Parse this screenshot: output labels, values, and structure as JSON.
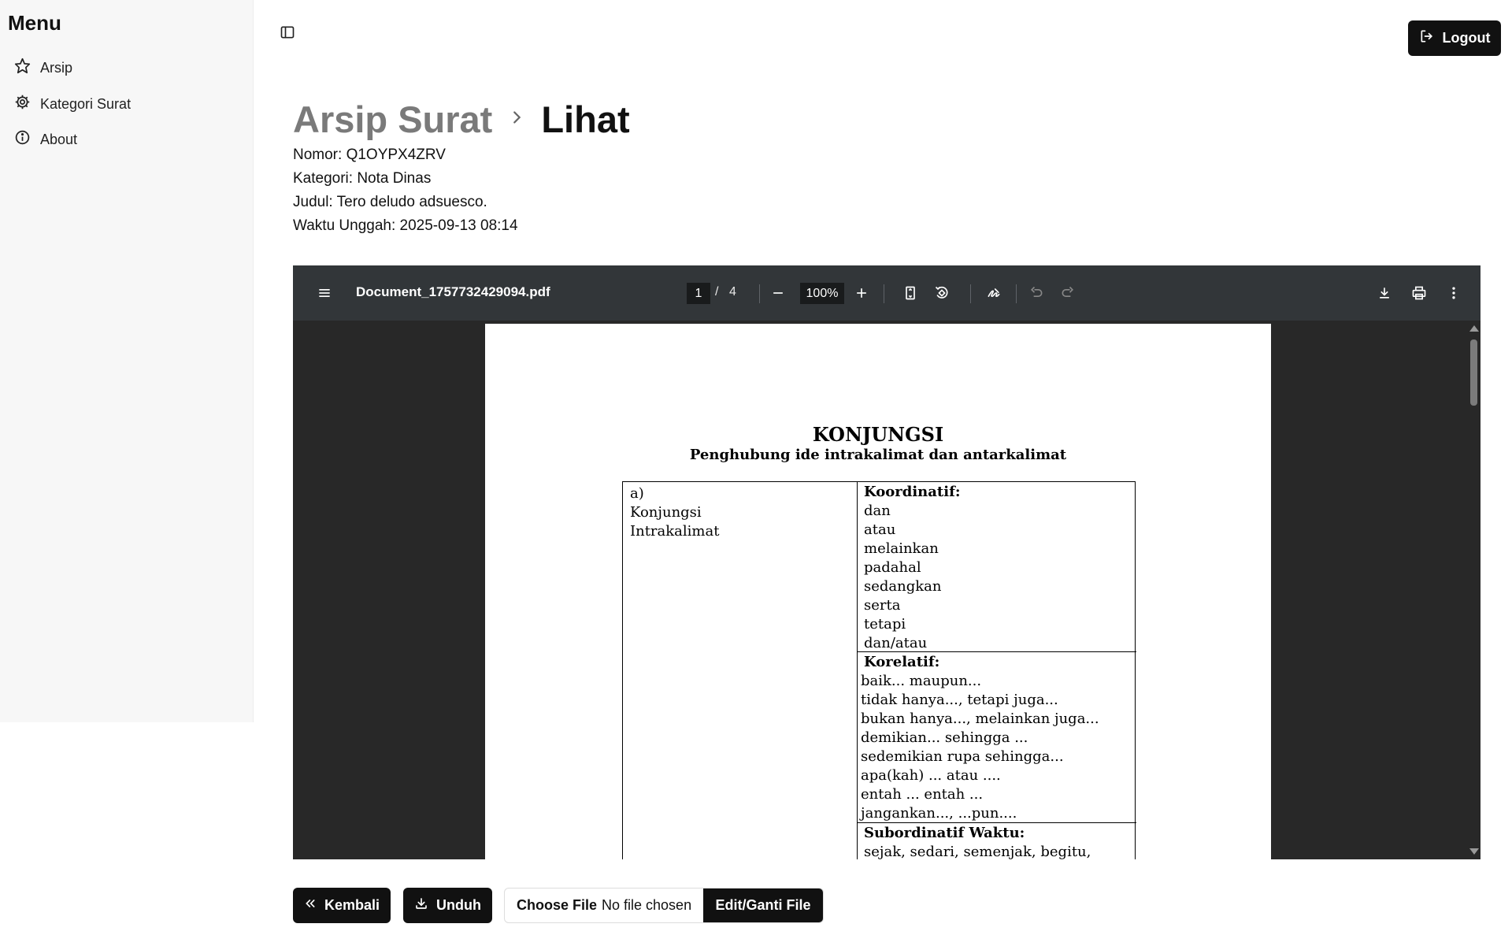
{
  "sidebar": {
    "title": "Menu",
    "items": [
      {
        "label": "Arsip",
        "icon": "star-icon"
      },
      {
        "label": "Kategori Surat",
        "icon": "gear-icon"
      },
      {
        "label": "About",
        "icon": "info-icon"
      }
    ]
  },
  "header": {
    "logout_label": "Logout"
  },
  "breadcrumb": {
    "parent": "Arsip Surat",
    "current": "Lihat"
  },
  "meta": {
    "nomor": "Nomor: Q1OYPX4ZRV",
    "kategori": "Kategori: Nota Dinas",
    "judul": "Judul: Tero deludo adsuesco.",
    "waktu": "Waktu Unggah: 2025-09-13 08:14"
  },
  "pdf_viewer": {
    "filename": "Document_1757732429094.pdf",
    "current_page": "1",
    "page_separator": "/",
    "total_pages": "4",
    "zoom": "100%",
    "document": {
      "title": "KONJUNGSI",
      "subtitle": "Penghubung ide intrakalimat dan antarkalimat",
      "left_col": [
        "a)",
        "Konjungsi",
        "Intrakalimat"
      ],
      "koordinatif_head": "Koordinatif:",
      "koordinatif_items": [
        "dan",
        "atau",
        "melainkan",
        "padahal",
        "sedangkan",
        "serta",
        "tetapi",
        "dan/atau"
      ],
      "korelatif_head": "Korelatif:",
      "korelatif_items": [
        "baik... maupun...",
        "tidak hanya..., tetapi juga...",
        "bukan hanya..., melainkan juga...",
        "demikian... sehingga ...",
        "sedemikian rupa sehingga...",
        "apa(kah) ... atau ....",
        "entah ... entah ...",
        "jangankan..., ...pun...."
      ],
      "subordinatif_head": "Subordinatif Waktu:",
      "subordinatif_items": [
        "sejak, sedari, semenjak, begitu, demi,"
      ]
    }
  },
  "actions": {
    "back_label": "Kembali",
    "download_label": "Unduh",
    "choose_file_label": "Choose File",
    "no_file_label": "No file chosen",
    "edit_file_label": "Edit/Ganti File"
  }
}
